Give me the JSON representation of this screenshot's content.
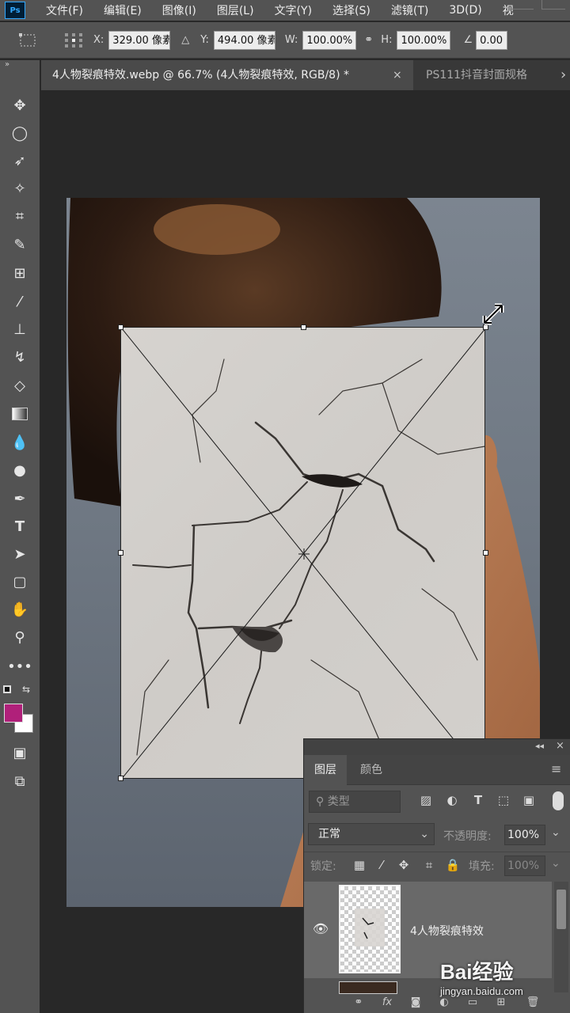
{
  "menubar": {
    "logo": "Ps",
    "items": [
      "文件(F)",
      "编辑(E)",
      "图像(I)",
      "图层(L)",
      "文字(Y)",
      "选择(S)",
      "滤镜(T)",
      "3D(D)",
      "视"
    ]
  },
  "options": {
    "x_label": "X:",
    "x_value": "329.00 像素",
    "y_label": "Y:",
    "y_value": "494.00 像素",
    "w_label": "W:",
    "w_value": "100.00%",
    "h_label": "H:",
    "h_value": "100.00%",
    "angle_value": "0.00"
  },
  "tabs": {
    "active": "4人物裂痕特效.webp @ 66.7% (4人物裂痕特效, RGB/8) *",
    "close_glyph": "×",
    "second": "PS111抖音封面规格",
    "overflow_glyph": "›"
  },
  "toolbar": {
    "tools": [
      "move-tool",
      "ellipse-marquee-tool",
      "lasso-tool",
      "magic-wand-tool",
      "crop-tool",
      "eyedropper-tool",
      "healing-brush-tool",
      "brush-tool",
      "clone-stamp-tool",
      "history-brush-tool",
      "eraser-tool",
      "gradient-tool",
      "blur-tool",
      "dodge-tool",
      "pen-tool",
      "type-tool",
      "path-selection-tool",
      "rectangle-tool",
      "hand-tool",
      "zoom-tool",
      "more-tools"
    ],
    "foreground_color": "#b0207a",
    "background_color": "#ffffff"
  },
  "layers_panel": {
    "tab_layers": "图层",
    "tab_color": "颜色",
    "search_placeholder": "类型",
    "blend_mode": "正常",
    "opacity_label": "不透明度:",
    "opacity_value": "100%",
    "lock_label": "锁定:",
    "fill_label": "填充:",
    "fill_value": "100%",
    "layer_name": "4人物裂痕特效"
  },
  "watermark": {
    "logo": "Bai经验",
    "url": "jingyan.baidu.com"
  }
}
